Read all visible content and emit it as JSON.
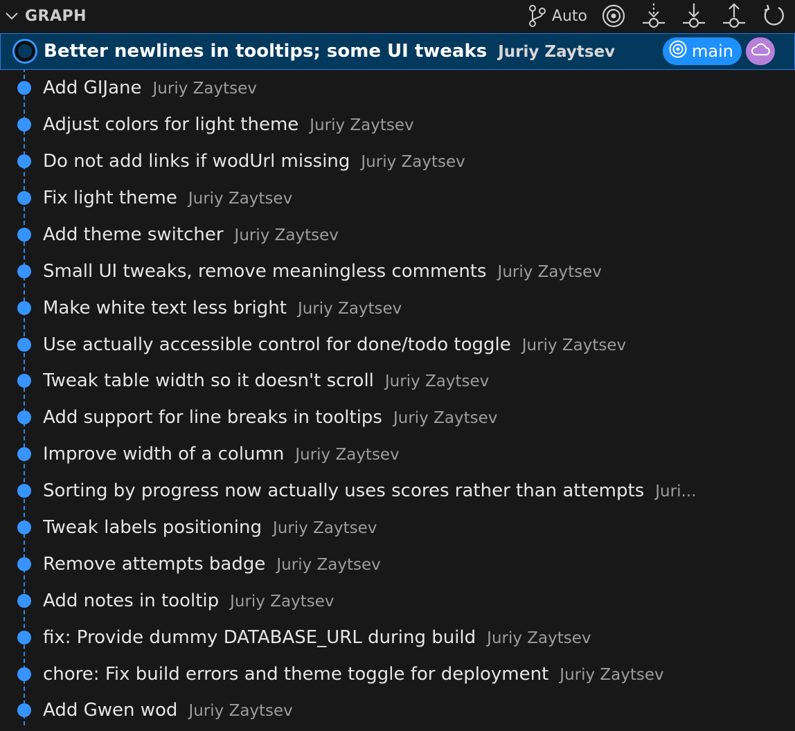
{
  "header": {
    "title": "GRAPH",
    "auto_label": "Auto",
    "icons": {
      "collapse": "chevron-down-icon",
      "auto": "git-branch-icon",
      "target": "target-icon",
      "fetch": "fetch-icon",
      "pull": "pull-icon",
      "push": "push-icon",
      "refresh": "refresh-icon"
    }
  },
  "colors": {
    "graph_line": "#3794ff",
    "selected_bg": "#04395e",
    "branch_badge": "#1f90ff",
    "remote_badge": "#b780d8"
  },
  "selected_commit": {
    "message": "Better newlines in tooltips; some UI tweaks",
    "author": "Juriy Zaytsev",
    "branch": "main",
    "branch_icon": "target-icon",
    "remote_icon": "cloud-icon"
  },
  "commits": [
    {
      "message": "Add GIJane",
      "author": "Juriy Zaytsev"
    },
    {
      "message": "Adjust colors for light theme",
      "author": "Juriy Zaytsev"
    },
    {
      "message": "Do not add links if wodUrl missing",
      "author": "Juriy Zaytsev"
    },
    {
      "message": "Fix light theme",
      "author": "Juriy Zaytsev"
    },
    {
      "message": "Add theme switcher",
      "author": "Juriy Zaytsev"
    },
    {
      "message": "Small UI tweaks, remove meaningless comments",
      "author": "Juriy Zaytsev"
    },
    {
      "message": "Make white text less bright",
      "author": "Juriy Zaytsev"
    },
    {
      "message": "Use actually accessible control for done/todo toggle",
      "author": "Juriy Zaytsev"
    },
    {
      "message": "Tweak table width so it doesn't scroll",
      "author": "Juriy Zaytsev"
    },
    {
      "message": "Add support for line breaks in tooltips",
      "author": "Juriy Zaytsev"
    },
    {
      "message": "Improve width of a column",
      "author": "Juriy Zaytsev"
    },
    {
      "message": "Sorting by progress now actually uses scores rather than attempts",
      "author": "Juri..."
    },
    {
      "message": "Tweak labels positioning",
      "author": "Juriy Zaytsev"
    },
    {
      "message": "Remove attempts badge",
      "author": "Juriy Zaytsev"
    },
    {
      "message": "Add notes in tooltip",
      "author": "Juriy Zaytsev"
    },
    {
      "message": "fix: Provide dummy DATABASE_URL during build",
      "author": "Juriy Zaytsev"
    },
    {
      "message": "chore: Fix build errors and theme toggle for deployment",
      "author": "Juriy Zaytsev"
    },
    {
      "message": "Add Gwen wod",
      "author": "Juriy Zaytsev"
    }
  ]
}
